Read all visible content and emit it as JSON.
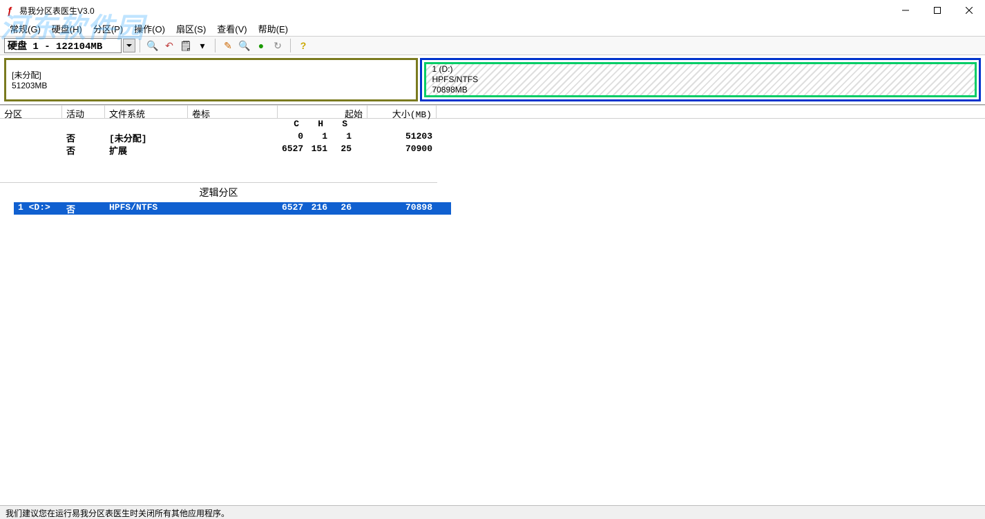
{
  "window": {
    "title": "易我分区表医生V3.0"
  },
  "menu": {
    "items": [
      {
        "label": "常规(G)"
      },
      {
        "label": "硬盘(H)"
      },
      {
        "label": "分区(P)"
      },
      {
        "label": "操作(O)"
      },
      {
        "label": "扇区(S)"
      },
      {
        "label": "查看(V)"
      },
      {
        "label": "帮助(E)"
      }
    ]
  },
  "toolbar": {
    "disk_label": "硬盘 1 - 122104MB"
  },
  "partition_map": {
    "unallocated": {
      "label": "[未分配]",
      "size": "51203MB"
    },
    "logical": {
      "name": "1 (D:)",
      "fs": "HPFS/NTFS",
      "size": "70898MB"
    }
  },
  "table": {
    "headers": {
      "partition": "分区",
      "active": "活动",
      "fs": "文件系统",
      "label": "卷标",
      "start": "起始",
      "size": "大小(MB)"
    },
    "chs": {
      "c": "C",
      "h": "H",
      "s": "S"
    },
    "primary_rows": [
      {
        "part": "",
        "active": "否",
        "fs": "[未分配]",
        "label": "",
        "c": "0",
        "h": "1",
        "s": "1",
        "size": "51203"
      },
      {
        "part": "",
        "active": "否",
        "fs": "扩展",
        "label": "",
        "c": "6527",
        "h": "151",
        "s": "25",
        "size": "70900"
      }
    ],
    "logical_header": "逻辑分区",
    "logical_rows": [
      {
        "part": "1 <D:>",
        "active": "否",
        "fs": "HPFS/NTFS",
        "label": "",
        "c": "6527",
        "h": "216",
        "s": "26",
        "size": "70898"
      }
    ]
  },
  "status": {
    "text": "我们建议您在运行易我分区表医生时关闭所有其他应用程序。"
  },
  "watermark": "河东软件园"
}
